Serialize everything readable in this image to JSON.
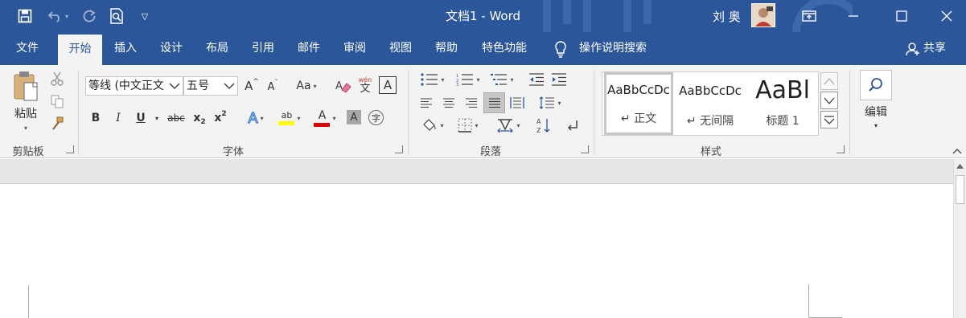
{
  "titlebar": {
    "title": "文档1 - Word",
    "user_name": "刘 奥",
    "colors": {
      "brand": "#2b579a"
    }
  },
  "tabs": [
    {
      "label": "文件"
    },
    {
      "label": "开始"
    },
    {
      "label": "插入"
    },
    {
      "label": "设计"
    },
    {
      "label": "布局"
    },
    {
      "label": "引用"
    },
    {
      "label": "邮件"
    },
    {
      "label": "审阅"
    },
    {
      "label": "视图"
    },
    {
      "label": "帮助"
    },
    {
      "label": "特色功能"
    }
  ],
  "tell_me": {
    "label": "操作说明搜索"
  },
  "share": {
    "label": "共享"
  },
  "ribbon": {
    "clipboard": {
      "paste_label": "粘贴",
      "group_label": "剪贴板"
    },
    "font": {
      "font_name": "等线 (中文正文",
      "font_size": "五号",
      "grow": "A",
      "shrink": "A",
      "change_case": "Aa",
      "phonetic_top": "wén",
      "phonetic_bottom": "文",
      "border_char": "A",
      "bold": "B",
      "italic": "I",
      "underline": "U",
      "strike": "abc",
      "subscript": "x",
      "subscript_small": "2",
      "superscript": "x",
      "superscript_small": "2",
      "text_effect": "A",
      "highlight": "ab",
      "font_color": "A",
      "char_shading": "A",
      "enclose_char": "字",
      "group_label": "字体"
    },
    "paragraph": {
      "group_label": "段落"
    },
    "styles": {
      "items": [
        {
          "preview": "AaBbCcDc",
          "name": "↵ 正文"
        },
        {
          "preview": "AaBbCcDc",
          "name": "↵ 无间隔"
        },
        {
          "preview": "AaBl",
          "name": "标题 1"
        }
      ],
      "group_label": "样式"
    },
    "editing": {
      "label": "编辑"
    }
  }
}
